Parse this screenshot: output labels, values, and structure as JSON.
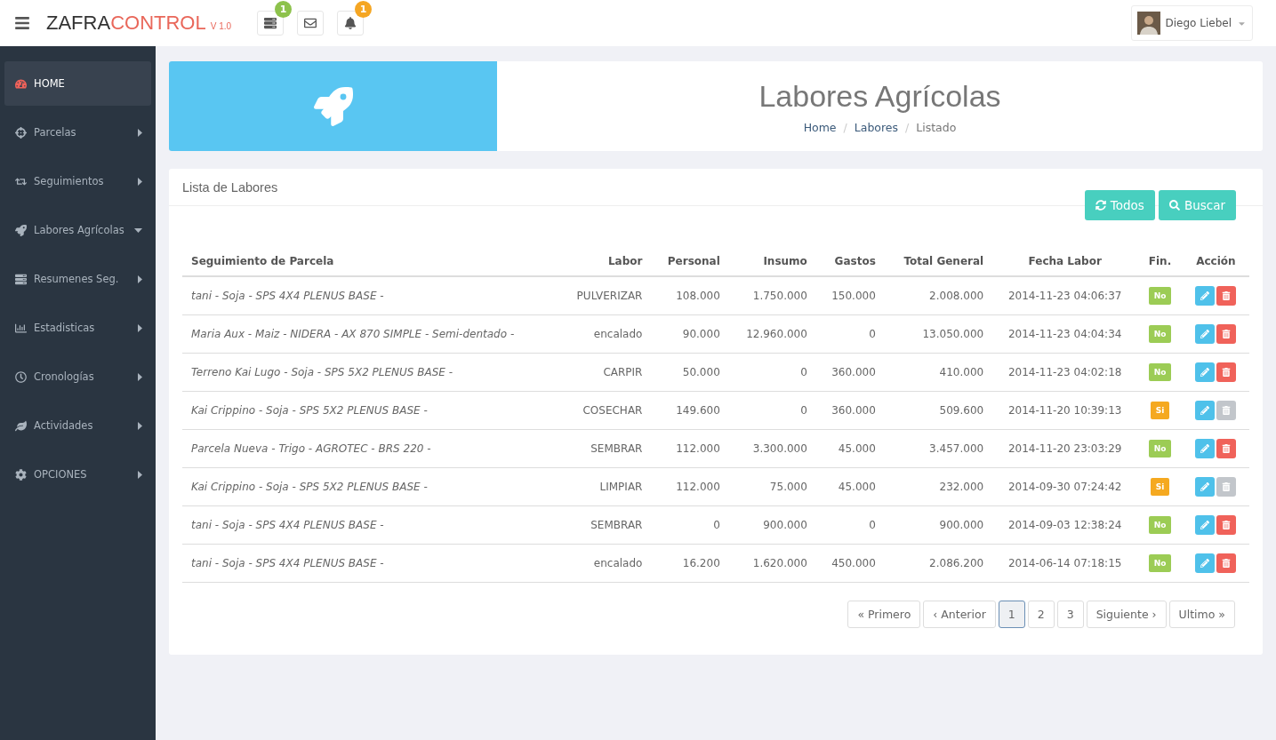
{
  "header": {
    "logo": {
      "part_1": "ZAFRA",
      "part_2": "CONTROL",
      "version": "V 1.0"
    },
    "toolbar": [
      {
        "kind": "tasks",
        "badge": "1",
        "color": "#8dc24c"
      },
      {
        "kind": "mail"
      },
      {
        "kind": "bell",
        "badge": "1",
        "color": "#f5a623"
      }
    ],
    "user": {
      "name": "Diego Liebel"
    }
  },
  "sidebar": {
    "items": [
      {
        "kind": "home",
        "label": "HOME",
        "selected": true
      },
      {
        "kind": "crosshair",
        "label": "Parcelas",
        "selected": false,
        "expanded": false
      },
      {
        "kind": "retweet",
        "label": "Seguimientos",
        "selected": false,
        "expanded": false
      },
      {
        "kind": "rocket",
        "label": "Labores Agrícolas",
        "selected": false,
        "expanded": true
      },
      {
        "kind": "server",
        "label": "Resumenes Seg.",
        "selected": false,
        "expanded": false
      },
      {
        "kind": "chart",
        "label": "Estadisticas",
        "selected": false,
        "expanded": false
      },
      {
        "kind": "clock",
        "label": "Cronologías",
        "selected": false,
        "expanded": false
      },
      {
        "kind": "leaf",
        "label": "Actividades",
        "selected": false,
        "expanded": false
      },
      {
        "kind": "cog",
        "label": "OPCIONES",
        "selected": false,
        "expanded": false
      }
    ]
  },
  "banner": {
    "title": "Labores Agrícolas",
    "breadcrumb": [
      {
        "label": "Home",
        "link": true
      },
      {
        "label": "Labores",
        "link": true
      },
      {
        "label": "Listado",
        "link": false
      }
    ],
    "separator": "/"
  },
  "card": {
    "title": "Lista de Labores",
    "buttons": [
      {
        "kind": "refresh",
        "label": "Todos"
      },
      {
        "kind": "search",
        "label": "Buscar"
      }
    ],
    "table": {
      "columns": [
        "Seguimiento de Parcela",
        "Labor",
        "Personal",
        "Insumo",
        "Gastos",
        "Total General",
        "Fecha Labor",
        "Fin.",
        "Acción"
      ],
      "rows": [
        {
          "parcela": "tani - Soja - SPS 4X4 PLENUS BASE -",
          "labor": "PULVERIZAR",
          "personal": "108.000",
          "insumo": "1.750.000",
          "gastos": "150.000",
          "total": "2.008.000",
          "fecha": "2014-11-23 04:06:37",
          "fin": "No",
          "finished": false
        },
        {
          "parcela": "Maria Aux - Maiz - NIDERA - AX 870 SIMPLE - Semi-dentado -",
          "labor": "encalado",
          "personal": "90.000",
          "insumo": "12.960.000",
          "gastos": "0",
          "total": "13.050.000",
          "fecha": "2014-11-23 04:04:34",
          "fin": "No",
          "finished": false
        },
        {
          "parcela": "Terreno Kai Lugo - Soja - SPS 5X2 PLENUS BASE -",
          "labor": "CARPIR",
          "personal": "50.000",
          "insumo": "0",
          "gastos": "360.000",
          "total": "410.000",
          "fecha": "2014-11-23 04:02:18",
          "fin": "No",
          "finished": false
        },
        {
          "parcela": "Kai Crippino - Soja - SPS 5X2 PLENUS BASE -",
          "labor": "COSECHAR",
          "personal": "149.600",
          "insumo": "0",
          "gastos": "360.000",
          "total": "509.600",
          "fecha": "2014-11-20 10:39:13",
          "fin": "Si",
          "finished": true
        },
        {
          "parcela": "Parcela Nueva - Trigo - AGROTEC - BRS 220 -",
          "labor": "SEMBRAR",
          "personal": "112.000",
          "insumo": "3.300.000",
          "gastos": "45.000",
          "total": "3.457.000",
          "fecha": "2014-11-20 23:03:29",
          "fin": "No",
          "finished": false
        },
        {
          "parcela": "Kai Crippino - Soja - SPS 5X2 PLENUS BASE -",
          "labor": "LIMPIAR",
          "personal": "112.000",
          "insumo": "75.000",
          "gastos": "45.000",
          "total": "232.000",
          "fecha": "2014-09-30 07:24:42",
          "fin": "Si",
          "finished": true
        },
        {
          "parcela": "tani - Soja - SPS 4X4 PLENUS BASE -",
          "labor": "SEMBRAR",
          "personal": "0",
          "insumo": "900.000",
          "gastos": "0",
          "total": "900.000",
          "fecha": "2014-09-03 12:38:24",
          "fin": "No",
          "finished": false
        },
        {
          "parcela": "tani - Soja - SPS 4X4 PLENUS BASE -",
          "labor": "encalado",
          "personal": "16.200",
          "insumo": "1.620.000",
          "gastos": "450.000",
          "total": "2.086.200",
          "fecha": "2014-06-14 07:18:15",
          "fin": "No",
          "finished": false
        }
      ]
    },
    "pagination": [
      {
        "label": "« Primero",
        "selected": false
      },
      {
        "label": "‹ Anterior",
        "selected": false
      },
      {
        "label": "1",
        "selected": true
      },
      {
        "label": "2",
        "selected": false
      },
      {
        "label": "3",
        "selected": false
      },
      {
        "label": "Siguiente ›",
        "selected": false
      },
      {
        "label": "Ultimo »",
        "selected": false
      }
    ]
  }
}
